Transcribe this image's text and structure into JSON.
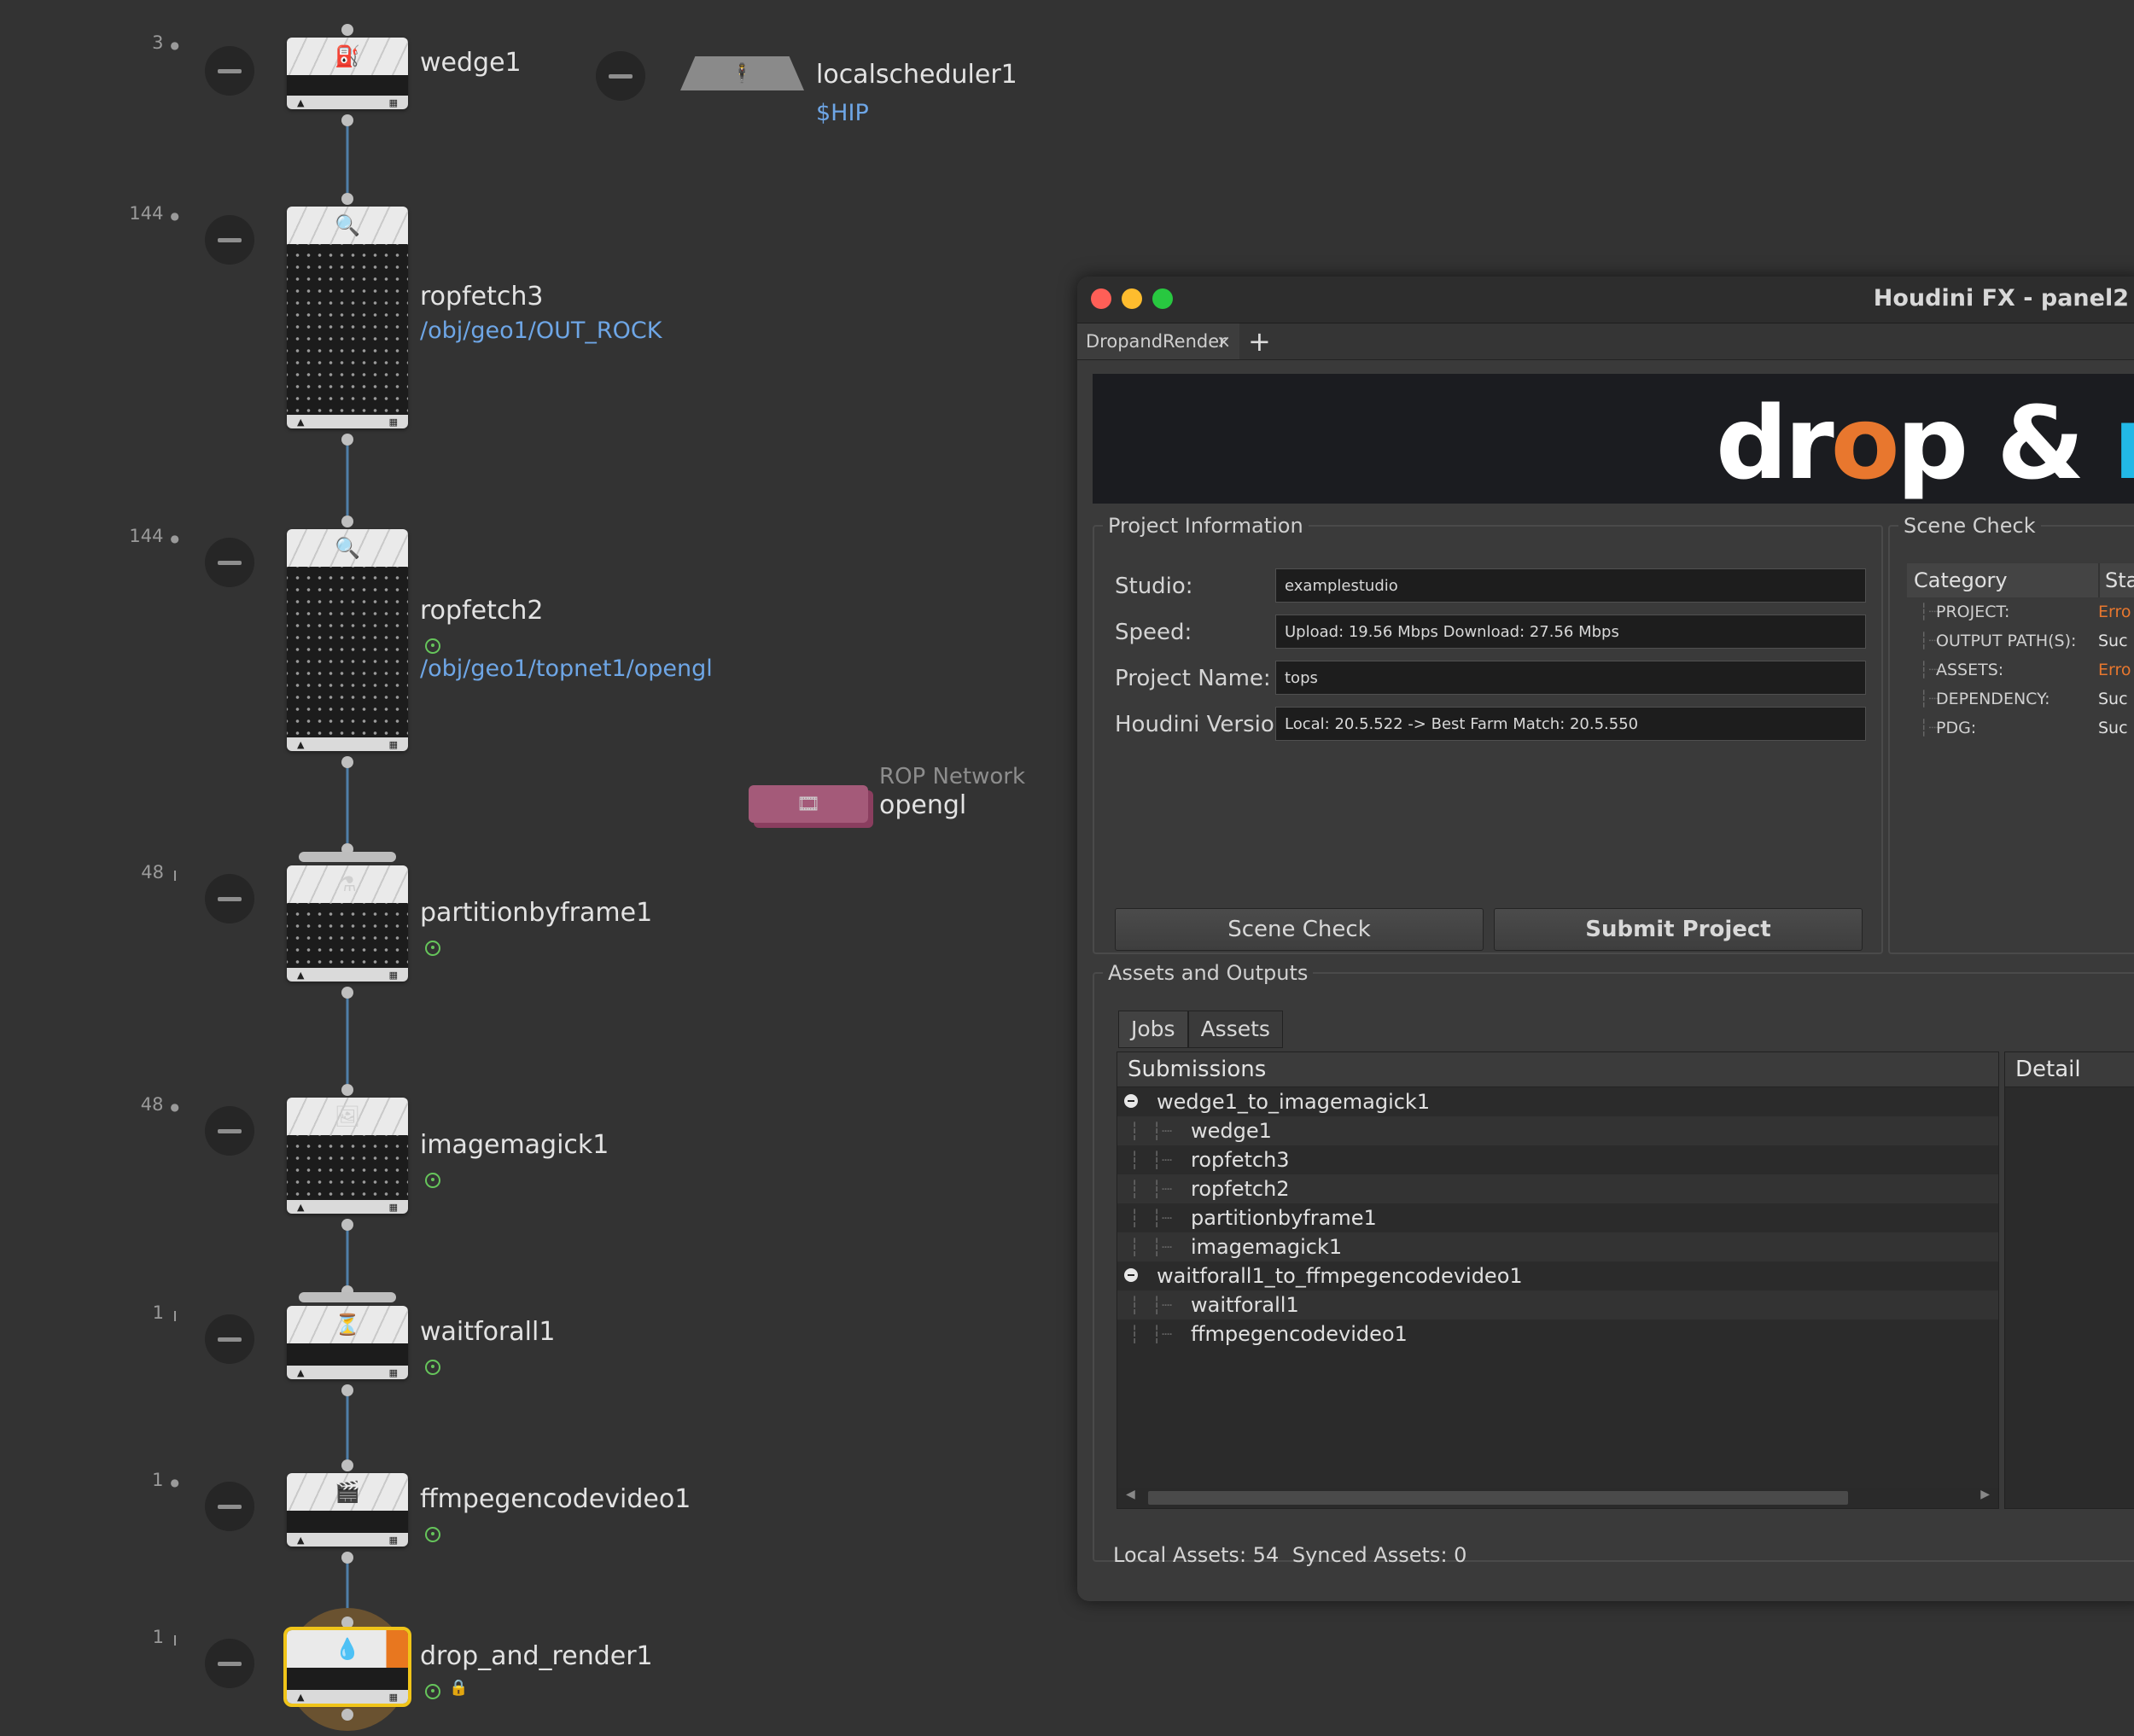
{
  "colors": {
    "accent": "#22b8e6",
    "error": "#e8772e",
    "success": "#e0e0e0",
    "node_path": "#6ea6e6"
  },
  "nodes": [
    {
      "id": "wedge1",
      "label": "wedge1",
      "count": "3",
      "icon": "wedge-icon",
      "path": ""
    },
    {
      "id": "ropfetch3",
      "label": "ropfetch3",
      "count": "144",
      "icon": "ropfetch-icon",
      "path": "/obj/geo1/OUT_ROCK"
    },
    {
      "id": "ropfetch2",
      "label": "ropfetch2",
      "count": "144",
      "icon": "ropfetch-icon",
      "path": "/obj/geo1/topnet1/opengl"
    },
    {
      "id": "partitionbyframe1",
      "label": "partitionbyframe1",
      "count": "48",
      "icon": "partition-icon",
      "path": ""
    },
    {
      "id": "imagemagick1",
      "label": "imagemagick1",
      "count": "48",
      "icon": "imagemagick-icon",
      "path": ""
    },
    {
      "id": "waitforall1",
      "label": "waitforall1",
      "count": "1",
      "icon": "waitforall-icon",
      "path": ""
    },
    {
      "id": "ffmpegencodevideo1",
      "label": "ffmpegencodevideo1",
      "count": "1",
      "icon": "ffmpeg-icon",
      "path": ""
    },
    {
      "id": "drop_and_render1",
      "label": "drop_and_render1",
      "count": "1",
      "icon": "dropandrender-icon",
      "path": ""
    }
  ],
  "scheduler": {
    "label": "localscheduler1",
    "path": "$HIP"
  },
  "rop_network": {
    "type_label": "ROP Network",
    "label": "opengl"
  },
  "window": {
    "title": "Houdini FX - panel2",
    "tab": "DropandRender",
    "tab_close": "×",
    "tab_add": "+",
    "logo": {
      "part1": "dr",
      "part2": "o",
      "part3": "p & ",
      "part4": "ren"
    }
  },
  "project": {
    "legend": "Project Information",
    "fields": [
      {
        "label": "Studio:",
        "value": "examplestudio"
      },
      {
        "label": "Speed:",
        "value": "Upload: 19.56 Mbps  Download: 27.56 Mbps"
      },
      {
        "label": "Project Name:",
        "value": "tops"
      },
      {
        "label": "Houdini Version:",
        "value": "Local: 20.5.522  ->  Best Farm Match: 20.5.550"
      }
    ],
    "scene_check_btn": "Scene Check",
    "submit_btn": "Submit Project"
  },
  "scene_check": {
    "legend": "Scene Check",
    "col_category": "Category",
    "col_status": "Sta",
    "rows": [
      {
        "category": "PROJECT:",
        "status": "Erro",
        "state": "error"
      },
      {
        "category": "OUTPUT PATH(S):",
        "status": "Suc",
        "state": "ok"
      },
      {
        "category": "ASSETS:",
        "status": "Erro",
        "state": "error"
      },
      {
        "category": "DEPENDENCY:",
        "status": "Suc",
        "state": "ok"
      },
      {
        "category": "PDG:",
        "status": "Suc",
        "state": "ok"
      }
    ]
  },
  "assets_outputs": {
    "legend": "Assets and Outputs",
    "tabs": [
      "Jobs",
      "Assets"
    ],
    "submissions_header": "Submissions",
    "detail_header": "Detail",
    "tree": [
      {
        "label": "wedge1_to_imagemagick1",
        "children": [
          "wedge1",
          "ropfetch3",
          "ropfetch2",
          "partitionbyframe1",
          "imagemagick1"
        ]
      },
      {
        "label": "waitforall1_to_ffmpegencodevideo1",
        "children": [
          "waitforall1",
          "ffmpegencodevideo1"
        ]
      }
    ],
    "local_assets_label": "Local Assets:",
    "local_assets": "54",
    "synced_assets_label": "Synced Assets:",
    "synced_assets": "0"
  }
}
